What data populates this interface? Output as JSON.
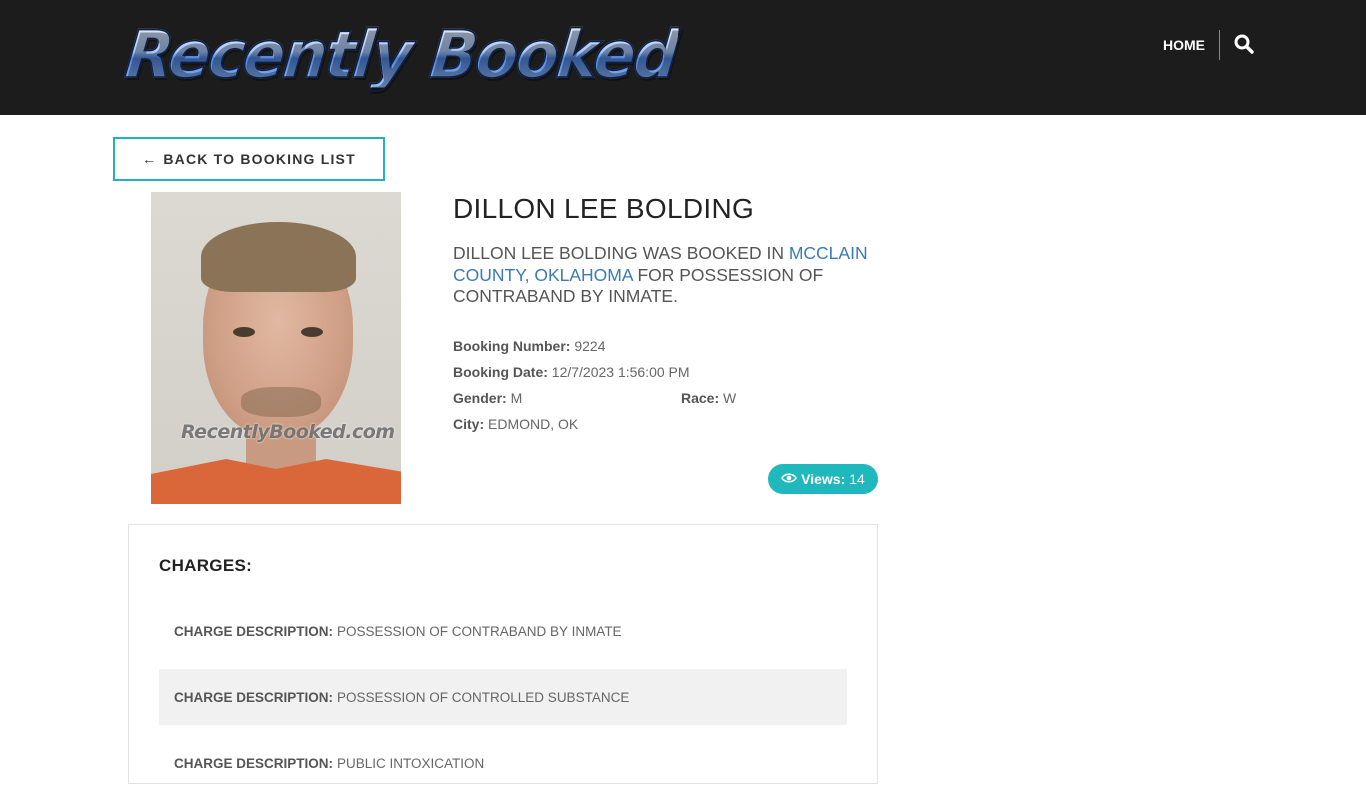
{
  "header": {
    "logo_text": "Recently Booked",
    "nav_home": "HOME",
    "search_icon": "search-icon",
    "background": "#1c1c1c"
  },
  "back_button": {
    "label": "BACK TO BOOKING LIST",
    "icon": "arrow-left-icon",
    "border_color": "#21b2bf"
  },
  "photo": {
    "watermark": "RecentlyBooked.com"
  },
  "inmate": {
    "name": "DILLON LEE BOLDING",
    "summary_prefix": "DILLON LEE BOLDING WAS BOOKED IN ",
    "summary_link": "MCCLAIN COUNTY, OKLAHOMA",
    "summary_suffix": " FOR POSSESSION OF CONTRABAND BY INMATE.",
    "booking_number_label": "Booking Number:",
    "booking_number": "9224",
    "booking_date_label": "Booking Date:",
    "booking_date": "12/7/2023 1:56:00 PM",
    "gender_label": "Gender:",
    "gender": "M",
    "race_label": "Race:",
    "race": "W",
    "city_label": "City:",
    "city": "EDMOND, OK"
  },
  "views": {
    "icon": "eye-icon",
    "label": "Views:",
    "count": "14",
    "color": "#1fb8bd"
  },
  "charges": {
    "title": "CHARGES:",
    "label": "CHARGE DESCRIPTION:",
    "items": [
      {
        "description": "POSSESSION OF CONTRABAND BY INMATE"
      },
      {
        "description": "POSSESSION OF CONTROLLED SUBSTANCE"
      },
      {
        "description": "PUBLIC INTOXICATION"
      }
    ]
  }
}
